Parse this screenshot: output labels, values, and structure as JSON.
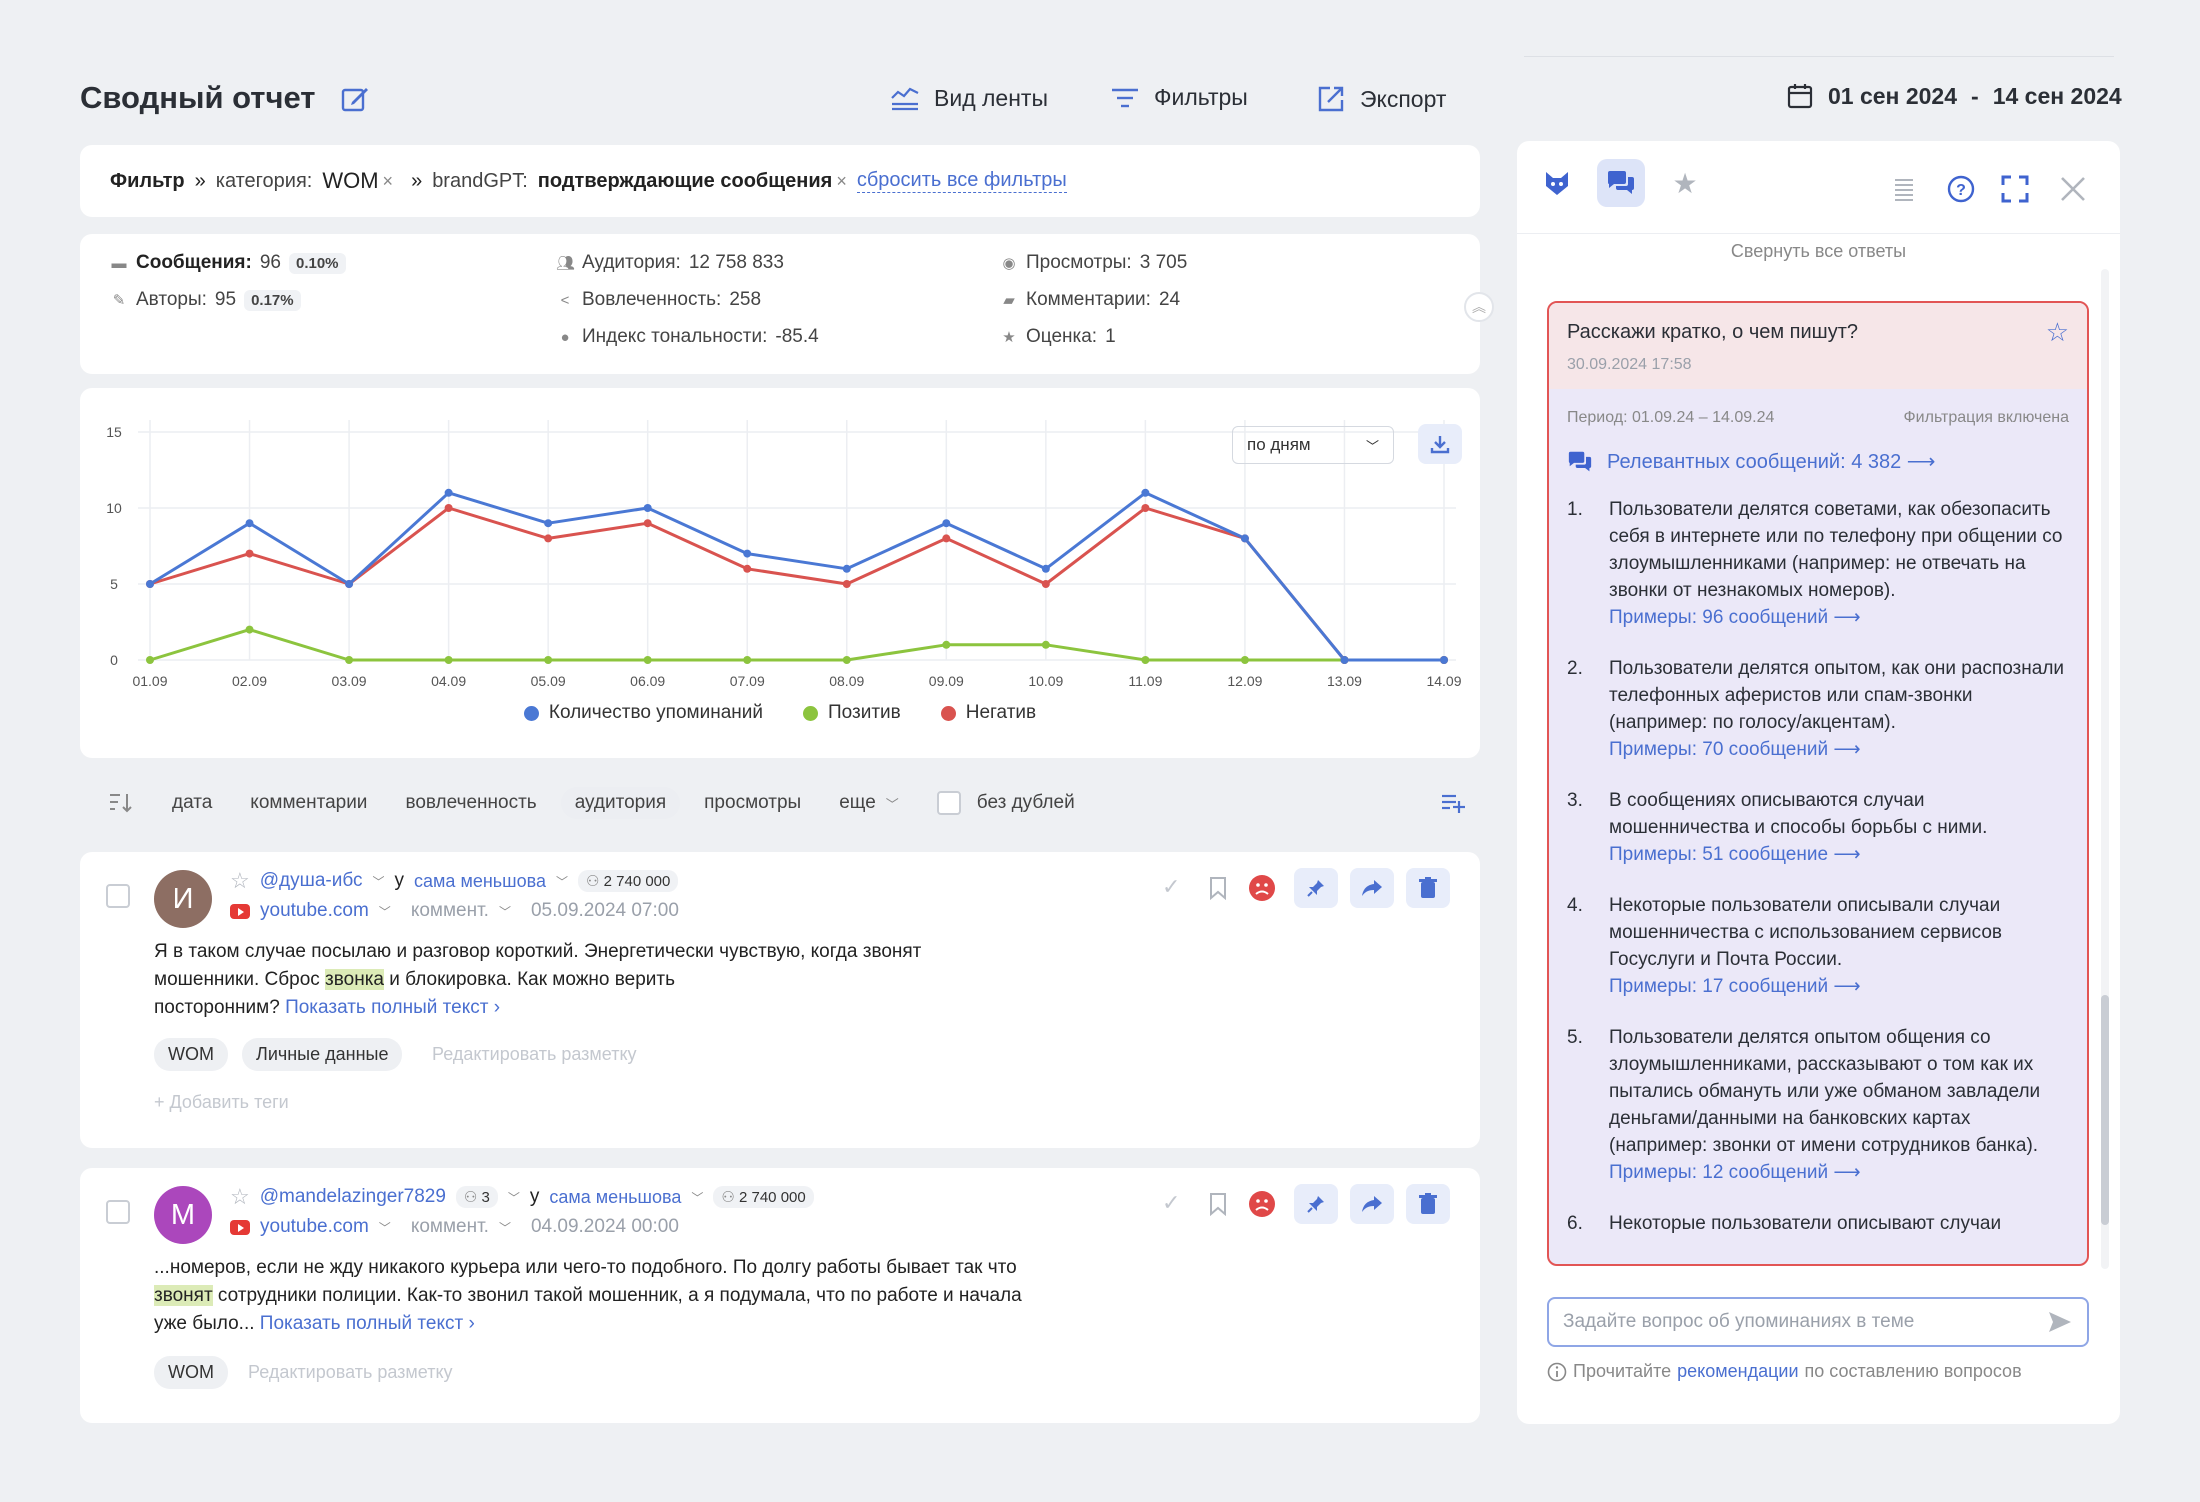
{
  "header": {
    "title": "Сводный отчет",
    "actions": [
      {
        "label": "Вид ленты",
        "icon": "feed-view-icon"
      },
      {
        "label": "Фильтры",
        "icon": "filter-icon"
      },
      {
        "label": "Экспорт",
        "icon": "export-icon"
      }
    ],
    "date_from": "01 сен 2024",
    "date_sep": "-",
    "date_to": "14 сен 2024"
  },
  "filters": {
    "label": "Фильтр",
    "sep": "»",
    "f1_key": "категория:",
    "f1_value": "WOM",
    "f2_key": "brandGPT:",
    "f2_value": "подтверждающие сообщения",
    "remove": "×",
    "reset": "сбросить все фильтры"
  },
  "stats": {
    "messages_label": "Сообщения:",
    "messages_value": "96",
    "messages_pct": "0.10%",
    "authors_label": "Авторы:",
    "authors_value": "95",
    "authors_pct": "0.17%",
    "audience_label": "Аудитория:",
    "audience_value": "12 758 833",
    "engagement_label": "Вовлеченность:",
    "engagement_value": "258",
    "tone_label": "Индекс тональности:",
    "tone_value": "-85.4",
    "views_label": "Просмотры:",
    "views_value": "3 705",
    "comments_label": "Комментарии:",
    "comments_value": "24",
    "rating_label": "Оценка:",
    "rating_value": "1"
  },
  "chart_data": {
    "type": "line",
    "categories": [
      "01.09",
      "02.09",
      "03.09",
      "04.09",
      "05.09",
      "06.09",
      "07.09",
      "08.09",
      "09.09",
      "10.09",
      "11.09",
      "12.09",
      "13.09",
      "14.09"
    ],
    "series": [
      {
        "name": "Количество упоминаний",
        "color": "#4a78d4",
        "values": [
          5,
          9,
          5,
          11,
          9,
          10,
          7,
          6,
          9,
          6,
          11,
          8,
          0,
          0
        ]
      },
      {
        "name": "Позитив",
        "color": "#8cc43e",
        "values": [
          0,
          2,
          0,
          0,
          0,
          0,
          0,
          0,
          1,
          1,
          0,
          0,
          0,
          0
        ]
      },
      {
        "name": "Негатив",
        "color": "#d9534f",
        "values": [
          5,
          7,
          5,
          10,
          8,
          9,
          6,
          5,
          8,
          5,
          10,
          8,
          0,
          0
        ]
      }
    ],
    "ylim": [
      0,
      15
    ],
    "yticks": [
      "0",
      "5",
      "10",
      "15"
    ],
    "grid": true,
    "legend": "bottom",
    "granularity": "по дням"
  },
  "sortbar": {
    "items": [
      "дата",
      "комментарии",
      "вовлеченность",
      "аудитория",
      "просмотры"
    ],
    "active": "аудитория",
    "more": "еще",
    "dedupe": "без дублей"
  },
  "posts": [
    {
      "initial": "И",
      "avatar_color": "#8d6e63",
      "author": "@душа-ибс",
      "author_count": "",
      "at": "у",
      "channel": "сама меньшова",
      "reach": "2 740 000",
      "source": "youtube.com",
      "type": "коммент.",
      "date": "05.09.2024 07:00",
      "text_1": "Я в таком случае посылаю и разговор короткий. Энергетически чувствую, когда звонят",
      "text_2a": "мошенники. Сброс ",
      "text_2hl": "звонка",
      "text_2b": " и блокировка. Как можно верить",
      "text_3": "посторонним?",
      "show_full": "Показать полный текст ›",
      "tags": [
        "WOM",
        "Личные данные"
      ],
      "edit_tags": "Редактировать разметку",
      "add_tags": "+  Добавить теги"
    },
    {
      "initial": "M",
      "avatar_color": "#ab47bc",
      "author": "@mandelazinger7829",
      "author_count": "3",
      "at": "у",
      "channel": "сама меньшова",
      "reach": "2 740 000",
      "source": "youtube.com",
      "type": "коммент.",
      "date": "04.09.2024 00:00",
      "text_1": "...номеров, если не жду никакого курьера или чего-то подобного. По долгу работы бывает так что",
      "text_2hl": "звонят",
      "text_2b": " сотрудники полиции. Как-то звонил такой мошенник, а я подумала, что по работе и начала",
      "text_3": "уже было...",
      "show_full": "Показать полный текст ›",
      "tags": [
        "WOM"
      ],
      "edit_tags": "Редактировать разметку"
    }
  ],
  "panel": {
    "collapse_all": "Свернуть все ответы",
    "question": "Расскажи кратко, о чем пишут?",
    "question_date": "30.09.2024 17:58",
    "period": "Период: 01.09.24 – 14.09.24",
    "filter_on": "Фильтрация включена",
    "relevant": "Релевантных сообщений: 4 382 ⟶",
    "answers": [
      {
        "n": "1.",
        "text": "Пользователи делятся советами, как обезопасить себя в интернете или по телефону при общении со злоумышленниками (например: не отвечать на звонки от незнакомых номеров).",
        "link": "Примеры: 96 сообщений ⟶"
      },
      {
        "n": "2.",
        "text": "Пользователи делятся опытом, как они распознали телефонных аферистов или спам-звонки (например: по голосу/акцентам).",
        "link": "Примеры: 70 сообщений ⟶"
      },
      {
        "n": "3.",
        "text": "В сообщениях описываются случаи мошенничества и способы борьбы с ними.",
        "link": "Примеры: 51 сообщение ⟶"
      },
      {
        "n": "4.",
        "text": "Некоторые пользователи описывали случаи мошенничества с использованием сервисов Госуслуги и Почта России.",
        "link": "Примеры: 17 сообщений ⟶"
      },
      {
        "n": "5.",
        "text": "Пользователи делятся опытом общения со злоумышленниками, рассказывают о том как их пытались обмануть или уже обманом завладели деньгами/данными на банковских картах (например: звонки от имени сотрудников банка).",
        "link": "Примеры: 12 сообщений ⟶"
      },
      {
        "n": "6.",
        "text": "Некоторые пользователи описывают случаи",
        "link": ""
      }
    ],
    "input_placeholder": "Задайте вопрос об упоминаниях в теме",
    "hint_before": "Прочитайте",
    "hint_link": "рекомендации",
    "hint_after": "по составлению вопросов"
  }
}
